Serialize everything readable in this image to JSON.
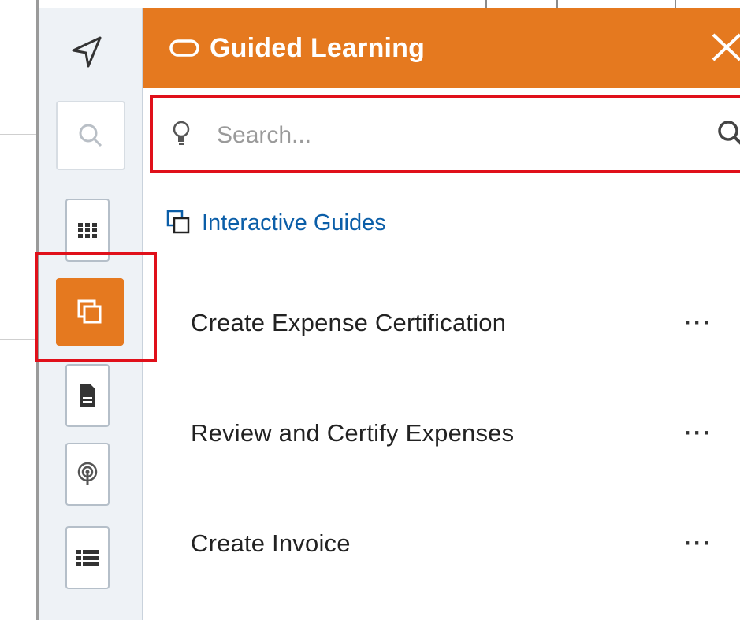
{
  "header": {
    "title": "Guided Learning"
  },
  "search": {
    "placeholder": "Search..."
  },
  "section": {
    "label": "Interactive Guides"
  },
  "guides": [
    {
      "label": "Create Expense Certification",
      "more": "···"
    },
    {
      "label": "Review and Certify Expenses",
      "more": "···"
    },
    {
      "label": "Create Invoice",
      "more": "···"
    }
  ],
  "colors": {
    "accent": "#e5791f",
    "highlight": "#e0101a",
    "link": "#0b5ea8",
    "sidebar": "#eef2f6"
  },
  "sidebar": {
    "items": [
      {
        "icon": "navigate-icon"
      },
      {
        "icon": "search-icon"
      },
      {
        "icon": "grid-icon"
      },
      {
        "icon": "guides-icon",
        "active": true
      },
      {
        "icon": "document-icon"
      },
      {
        "icon": "broadcast-icon"
      },
      {
        "icon": "list-icon"
      }
    ]
  }
}
